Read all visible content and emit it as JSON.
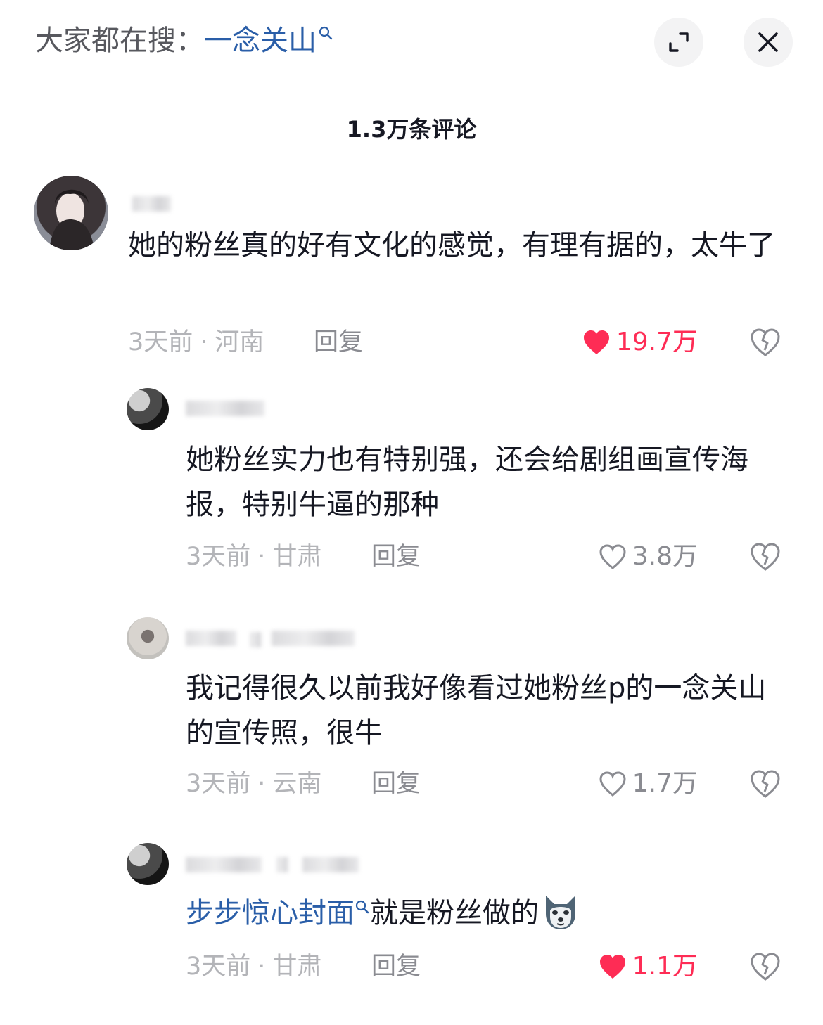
{
  "header": {
    "search_prefix": "大家都在搜：",
    "search_term": "一念关山"
  },
  "comments_count": "1.3万条评论",
  "comments": [
    {
      "text": "她的粉丝真的好有文化的感觉，有理有据的，太牛了",
      "time": "3天前",
      "location": "河南",
      "reply": "回复",
      "likes": "19.7万",
      "liked": true
    },
    {
      "text": "她粉丝实力也有特别强，还会给剧组画宣传海报，特别牛逼的那种",
      "time": "3天前",
      "location": "甘肃",
      "reply": "回复",
      "likes": "3.8万",
      "liked": false
    },
    {
      "text": "我记得很久以前我好像看过她粉丝p的一念关山的宣传照，很牛",
      "time": "3天前",
      "location": "云南",
      "reply": "回复",
      "likes": "1.7万",
      "liked": false
    },
    {
      "link_text": "步步惊心封面",
      "text": "就是粉丝做的",
      "time": "3天前",
      "location": "甘肃",
      "reply": "回复",
      "likes": "1.1万",
      "liked": true
    }
  ],
  "colors": {
    "accent_like": "#fe2c55",
    "link": "#2a5ea8",
    "meta": "#b3b4b8"
  },
  "icons": [
    "search-icon",
    "expand-icon",
    "close-icon",
    "heart-icon",
    "dislike-icon",
    "dog-emoji"
  ]
}
